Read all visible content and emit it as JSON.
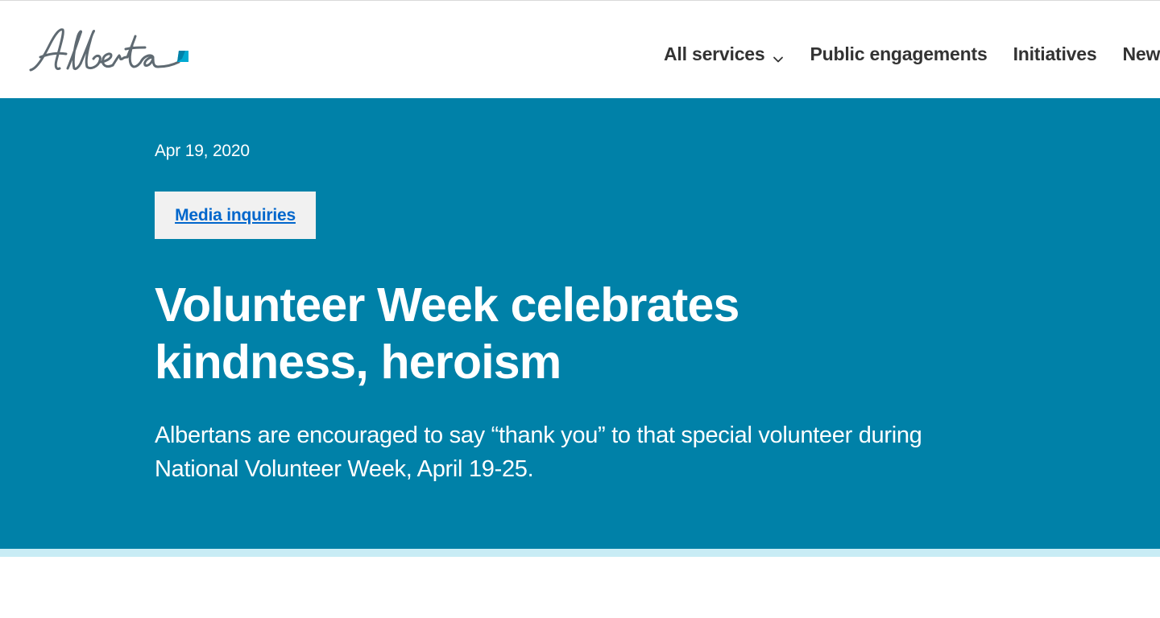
{
  "header": {
    "logo_text": "Alberta",
    "nav": [
      {
        "label": "All services",
        "has_dropdown": true
      },
      {
        "label": "Public engagements",
        "has_dropdown": false
      },
      {
        "label": "Initiatives",
        "has_dropdown": false
      },
      {
        "label": "New",
        "has_dropdown": false
      }
    ]
  },
  "article": {
    "date": "Apr 19, 2020",
    "tag_label": "Media inquiries",
    "headline_line1": "Volunteer Week celebrates",
    "headline_line2": "kindness, heroism",
    "lede_line1": "Albertans are encouraged to say “thank you” to that special volunteer during",
    "lede_line2": "National Volunteer Week, April 19-25."
  },
  "colors": {
    "hero_background": "#0081a8",
    "hero_stripe": "#c8ecf5",
    "logo_blue": "#00aad2",
    "link_blue": "#0066cc",
    "nav_text": "#333333"
  },
  "icons": {
    "nav_dropdown": "chevron-down-icon"
  }
}
